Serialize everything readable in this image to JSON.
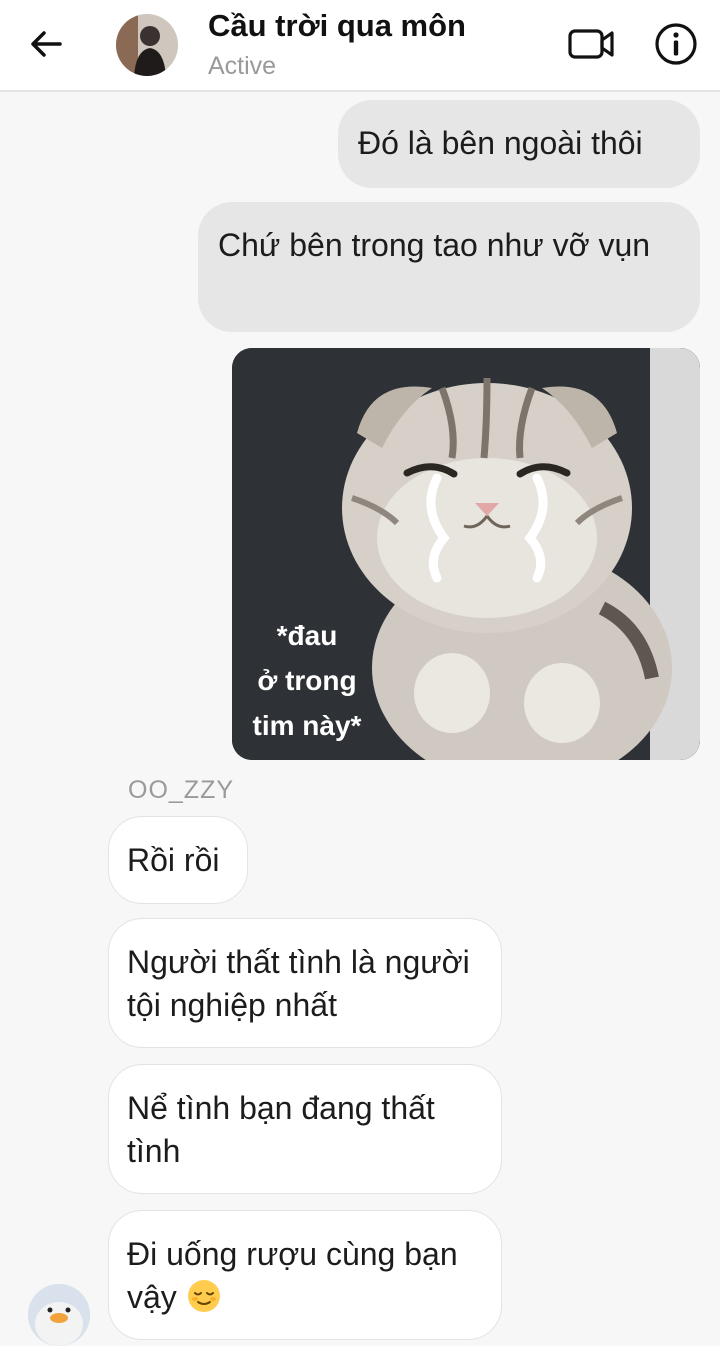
{
  "header": {
    "contact_name": "Cầu trời qua môn",
    "status": "Active",
    "back_icon": "arrow-left-icon",
    "video_icon": "video-call-icon",
    "info_icon": "info-icon"
  },
  "messages": {
    "outgoing": [
      {
        "text": "Đó là bên ngoài thôi"
      },
      {
        "text": "Chứ bên trong tao như vỡ vụn"
      }
    ],
    "image": {
      "caption": "*đau\nở trong\ntim này*"
    },
    "sender_name": "OO_ZZY",
    "incoming": [
      {
        "text": "Rồi rồi"
      },
      {
        "text": "Người thất tình là người tội nghiệp nhất"
      },
      {
        "text": "Nể tình bạn đang thất tình"
      },
      {
        "text": "Đi uống rượu cùng bạn vậy",
        "emoji": "relieved-face-emoji"
      }
    ]
  },
  "colors": {
    "outgoing_bubble": "#e6e6e6",
    "incoming_bubble": "#ffffff",
    "background": "#f7f7f7",
    "muted_text": "#9a9a9a"
  }
}
